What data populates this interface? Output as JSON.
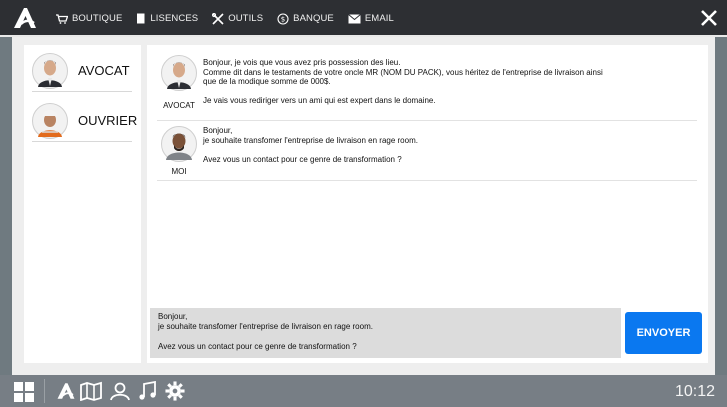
{
  "topbar": {
    "menu": [
      {
        "label": "BOUTIQUE",
        "icon": "cart-icon"
      },
      {
        "label": "LISENCES",
        "icon": "document-icon"
      },
      {
        "label": "OUTILS",
        "icon": "tools-icon"
      },
      {
        "label": "BANQUE",
        "icon": "bank-icon"
      },
      {
        "label": "EMAIL",
        "icon": "mail-icon"
      }
    ]
  },
  "contacts": [
    {
      "name": "AVOCAT"
    },
    {
      "name": "OUVRIER"
    }
  ],
  "messages": [
    {
      "sender": "AVOCAT",
      "text": "Bonjour, je vois que vous avez pris possession des lieu.\nComme dit dans le testaments de votre oncle MR (NOM DU PACK), vous héritez de l'entreprise de livraison ainsi\nque de la modique somme de 000$.\n\nJe vais vous rediriger vers un ami qui est expert dans le domaine."
    },
    {
      "sender": "MOI",
      "text": "Bonjour,\nje souhaite transfomer l'entreprise de livraison en rage room.\n\nAvez vous un contact pour ce genre de transformation ?"
    }
  ],
  "composer": {
    "text": "Bonjour,\nje souhaite transfomer l'entreprise de livraison en rage room.\n\nAvez vous un contact pour ce genre de transformation ?",
    "send_label": "ENVOYER"
  },
  "taskbar": {
    "clock": "10:12"
  },
  "colors": {
    "accent": "#0a78f0",
    "topbar": "#2d2f33",
    "taskbar": "#777e85"
  }
}
